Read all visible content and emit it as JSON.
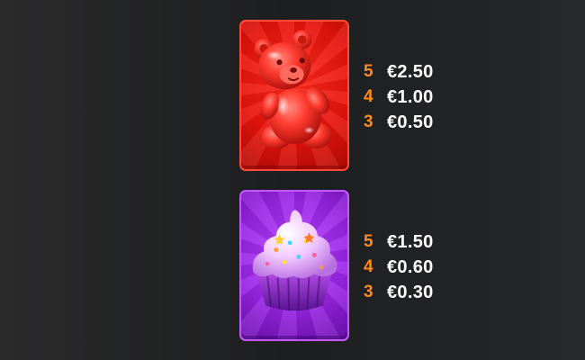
{
  "colors": {
    "background": "#1f2021",
    "count_color": "#ff8a1f",
    "value_color": "#ffffff",
    "bear_card": "#e8140d",
    "cupcake_card": "#9a25e6"
  },
  "symbols": [
    {
      "name": "gummy-bear",
      "icon": "gummy-bear-icon",
      "payouts": [
        {
          "count": "5",
          "value": "€2.50"
        },
        {
          "count": "4",
          "value": "€1.00"
        },
        {
          "count": "3",
          "value": "€0.50"
        }
      ]
    },
    {
      "name": "cupcake",
      "icon": "cupcake-icon",
      "payouts": [
        {
          "count": "5",
          "value": "€1.50"
        },
        {
          "count": "4",
          "value": "€0.60"
        },
        {
          "count": "3",
          "value": "€0.30"
        }
      ]
    }
  ]
}
